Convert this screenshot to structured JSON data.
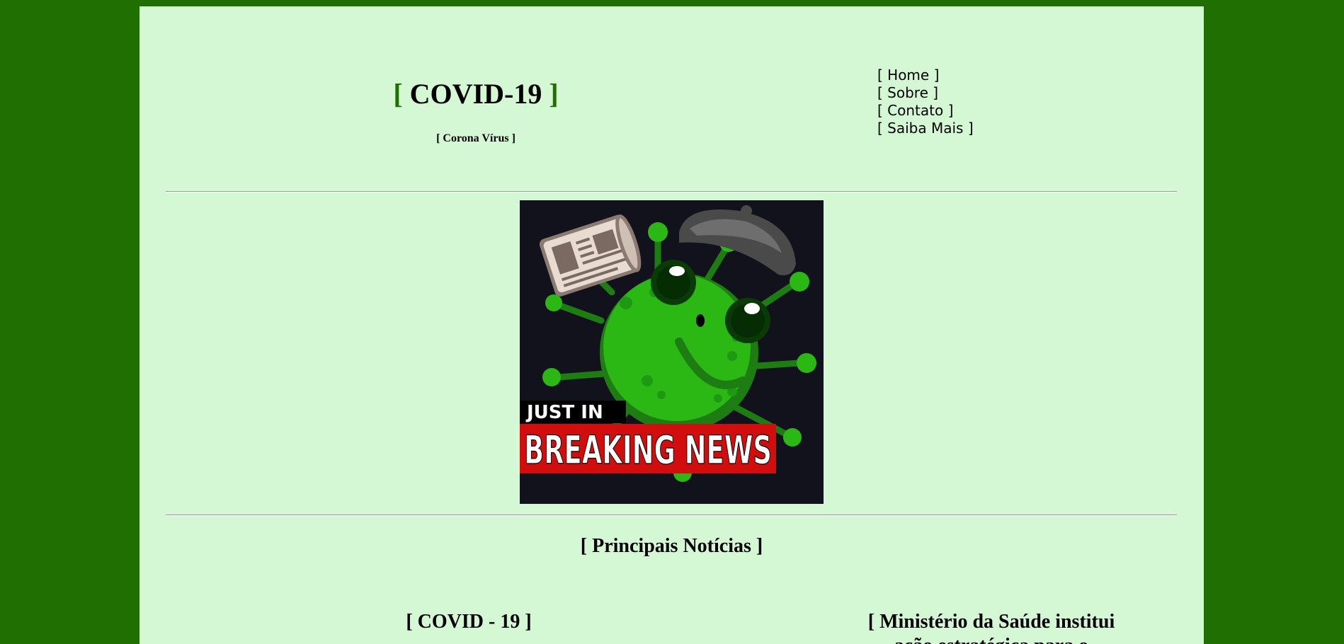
{
  "header": {
    "title_open": "[",
    "title_text": " COVID-19 ",
    "title_close": "]",
    "subtitle": "[ Corona Vírus ]"
  },
  "nav": {
    "items": [
      {
        "label": "[ Home ]"
      },
      {
        "label": "[ Sobre ]"
      },
      {
        "label": "[ Contato ]"
      },
      {
        "label": "[ Saiba Mais ]"
      }
    ]
  },
  "hero": {
    "caption_top": "JUST IN",
    "caption_main": "BREAKING NEWS",
    "icon": "virus-character-reading-newspaper-icon",
    "colors": {
      "background": "#12121c",
      "virus": "#2bb714",
      "virus_dark": "#1d7d12",
      "banner": "#d10d0d"
    }
  },
  "main": {
    "section_heading": "[ Principais Notícias ]",
    "news": [
      {
        "title": "[ COVID - 19 ]"
      },
      {
        "title": "[ Ministério da Saúde institui ação estratégica para o"
      }
    ]
  },
  "colors": {
    "outer_background": "#1f6f02",
    "page_background": "#d4f8d4",
    "accent": "#1f6f02"
  }
}
